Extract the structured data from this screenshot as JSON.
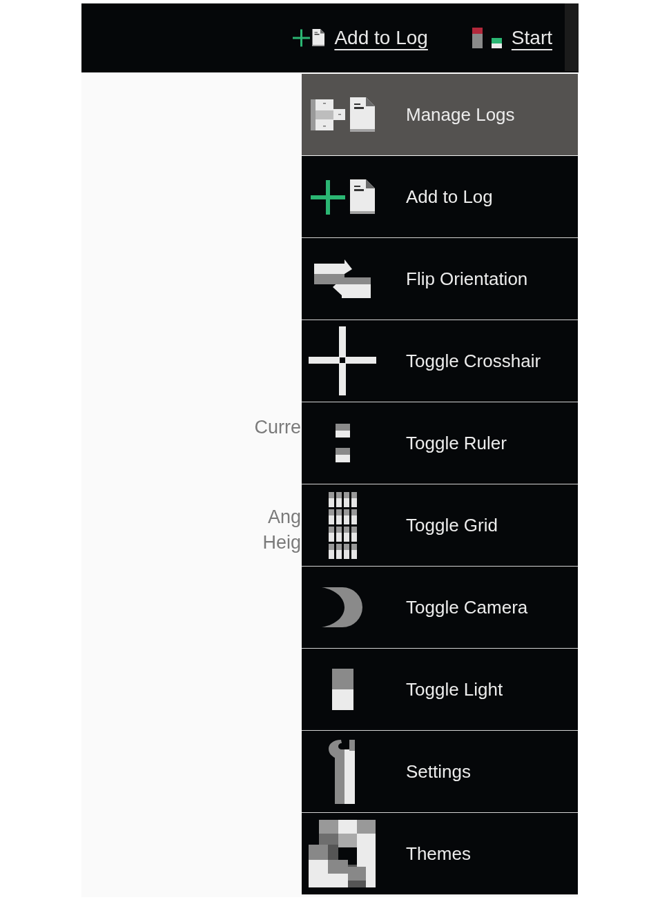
{
  "toolbar": {
    "actions": [
      {
        "label": "Add to Log",
        "kind": "add"
      },
      {
        "label": "Start",
        "kind": "start"
      }
    ]
  },
  "content": {
    "labels": [
      {
        "text": "Curre"
      },
      {
        "text": "Ang"
      },
      {
        "text": "Heig"
      }
    ]
  },
  "menu": {
    "items": [
      {
        "label": "Manage Logs",
        "kind": "manage",
        "selected": true
      },
      {
        "label": "Add to Log",
        "kind": "add",
        "selected": false
      },
      {
        "label": "Flip Orientation",
        "kind": "flip",
        "selected": false
      },
      {
        "label": "Toggle Crosshair",
        "kind": "crosshair",
        "selected": false
      },
      {
        "label": "Toggle Ruler",
        "kind": "ruler",
        "selected": false
      },
      {
        "label": "Toggle Grid",
        "kind": "grid",
        "selected": false
      },
      {
        "label": "Toggle Camera",
        "kind": "camera",
        "selected": false
      },
      {
        "label": "Toggle Light",
        "kind": "light",
        "selected": false
      },
      {
        "label": "Settings",
        "kind": "settings",
        "selected": false
      },
      {
        "label": "Themes",
        "kind": "themes",
        "selected": false
      }
    ]
  }
}
